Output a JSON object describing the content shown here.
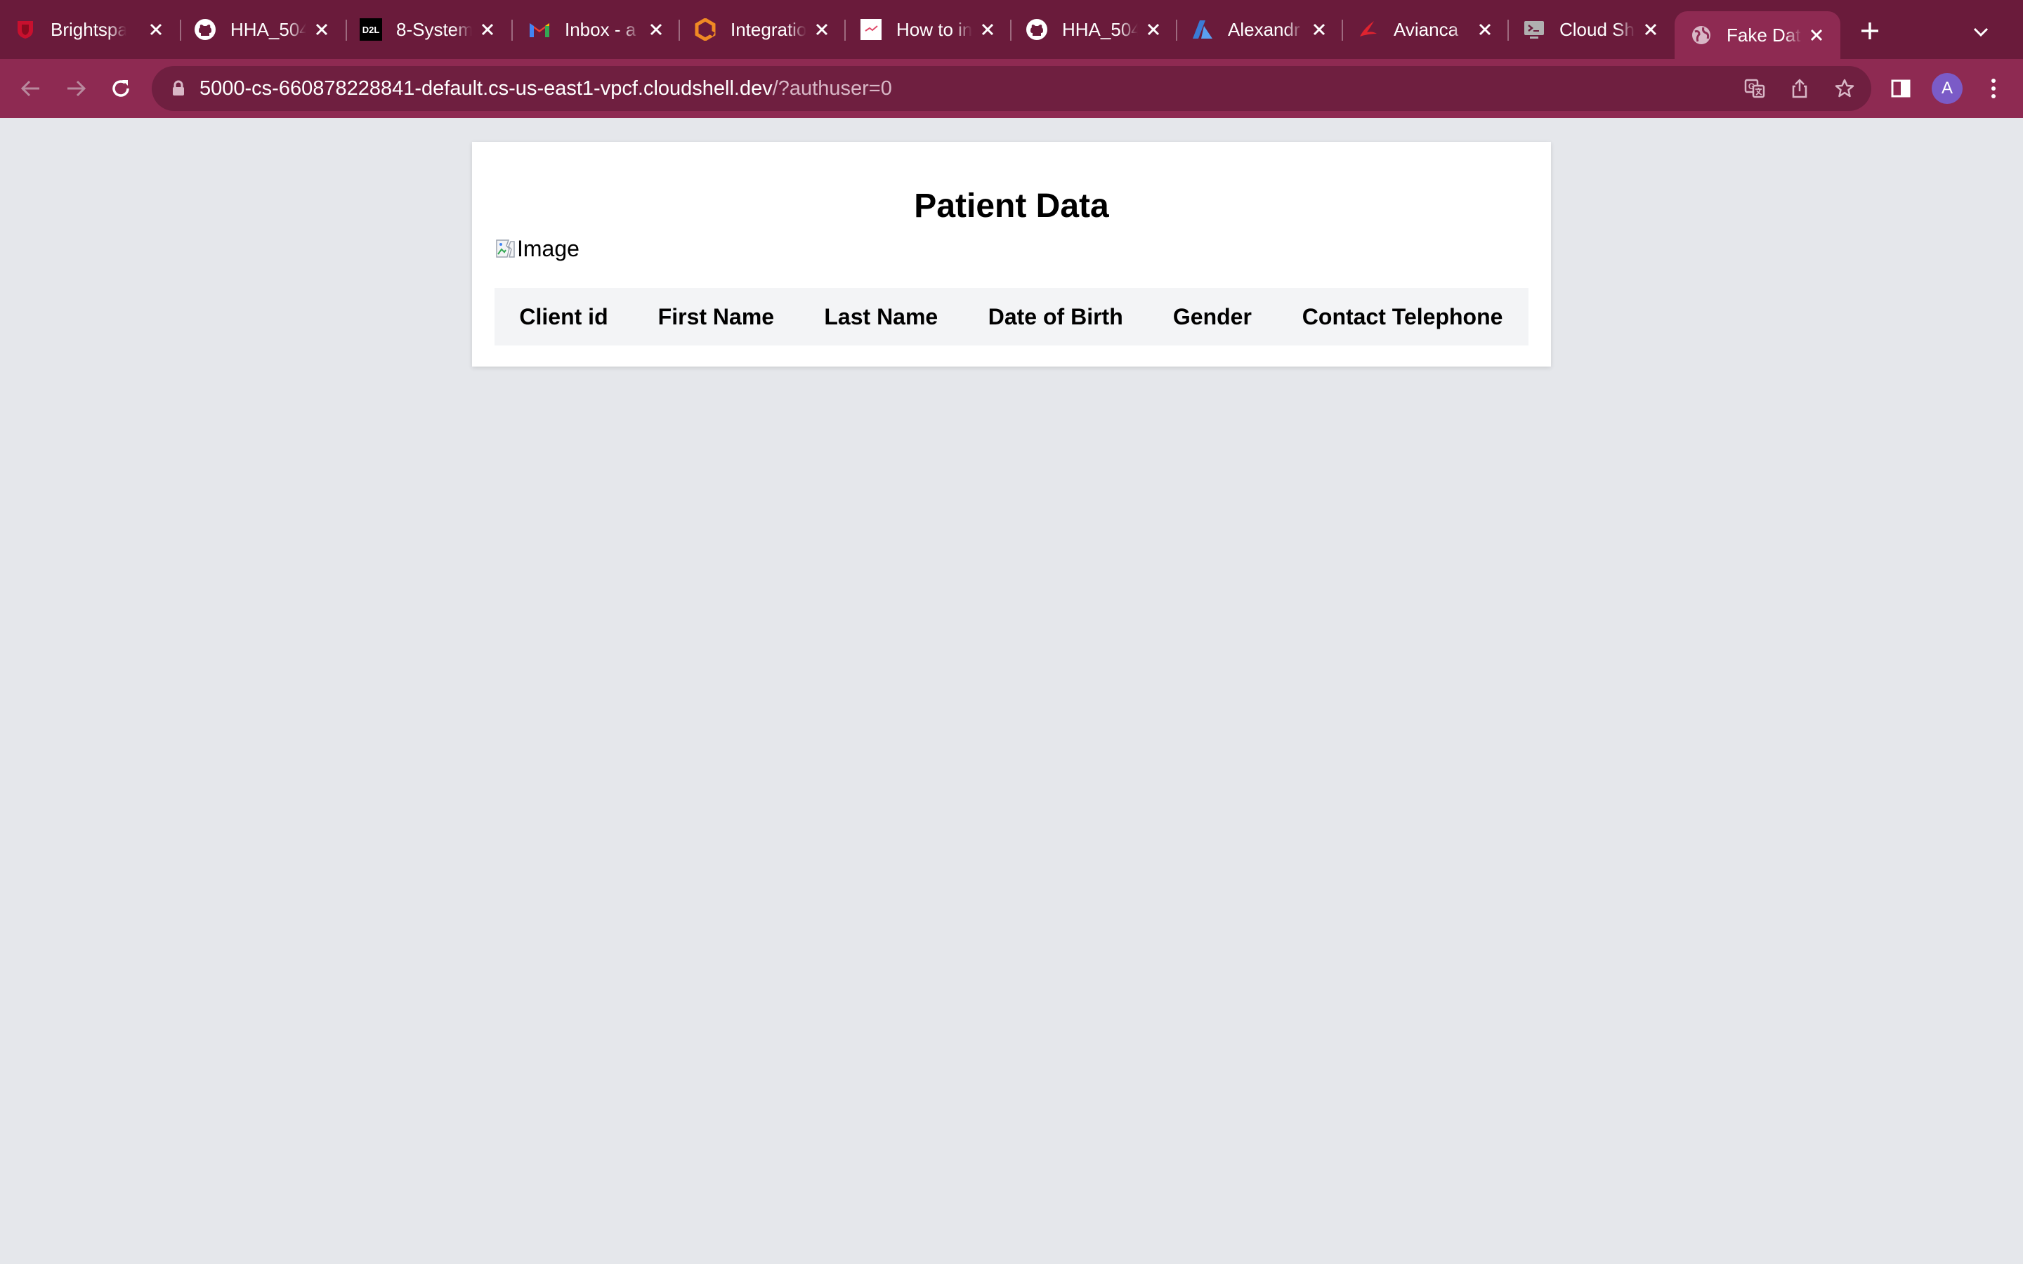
{
  "browser": {
    "tabs": [
      {
        "title": "Brightspace",
        "icon": "brightspace-icon",
        "active": false
      },
      {
        "title": "HHA_504",
        "icon": "github-icon",
        "active": false
      },
      {
        "title": "8-System",
        "icon": "d2l-icon",
        "active": false
      },
      {
        "title": "Inbox - a",
        "icon": "gmail-icon",
        "active": false
      },
      {
        "title": "Integration",
        "icon": "integration-icon",
        "active": false
      },
      {
        "title": "How to in",
        "icon": "howto-icon",
        "active": false
      },
      {
        "title": "HHA_504",
        "icon": "github-icon",
        "active": false
      },
      {
        "title": "Alexandr",
        "icon": "azure-icon",
        "active": false
      },
      {
        "title": "Avianca",
        "icon": "avianca-icon",
        "active": false
      },
      {
        "title": "Cloud Sh",
        "icon": "cloudshell-icon",
        "active": false
      },
      {
        "title": "Fake Dat",
        "icon": "globe-icon",
        "active": true
      }
    ],
    "d2l_favicon_text": "D2L",
    "url_host": "5000-cs-660878228841-default.cs-us-east1-vpcf.cloudshell.dev",
    "url_path": "/?authuser=0",
    "profile_initial": "A"
  },
  "page": {
    "title": "Patient Data",
    "image_alt": "Image",
    "table_headers": [
      "Client id",
      "First Name",
      "Last Name",
      "Date of Birth",
      "Gender",
      "Contact Telephone"
    ]
  },
  "colors": {
    "tabstrip": "#6a1b3b",
    "toolbar": "#8e2a52",
    "page_background": "#e5e7eb",
    "table_header_background": "#f3f4f6"
  }
}
